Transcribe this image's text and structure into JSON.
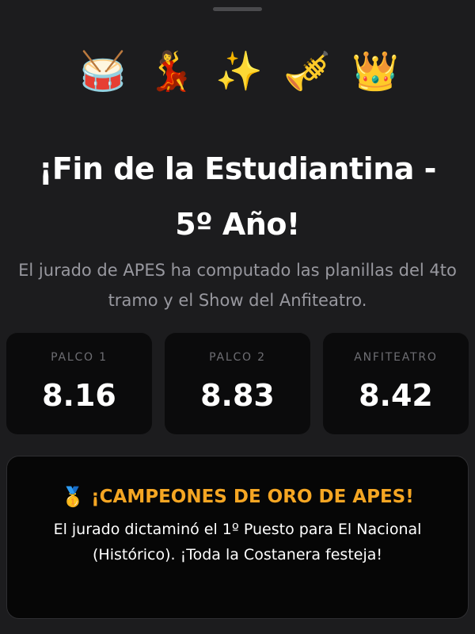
{
  "emojis": {
    "drum": "🥁",
    "dancer": "💃",
    "sparkles": "✨",
    "trumpet": "🎺",
    "crown": "👑"
  },
  "title": "¡Fin de la Estudiantina - 5º Año!",
  "subtitle": "El jurado de APES ha computado las planillas del 4to tramo y el Show del Anfiteatro.",
  "scores": [
    {
      "label": "PALCO 1",
      "value": "8.16"
    },
    {
      "label": "PALCO 2",
      "value": "8.83"
    },
    {
      "label": "ANFITEATRO",
      "value": "8.42"
    }
  ],
  "banner": {
    "medal": "🥇",
    "title": "¡CAMPEONES DE ORO DE APES!",
    "text": "El jurado dictaminó el 1º Puesto para El Nacional (Histórico). ¡Toda la Costanera festeja!",
    "title_color": "#f5a623"
  },
  "colors": {
    "background": "#1c1c1e",
    "card": "#0b0b0c",
    "muted_text": "#98989f"
  }
}
